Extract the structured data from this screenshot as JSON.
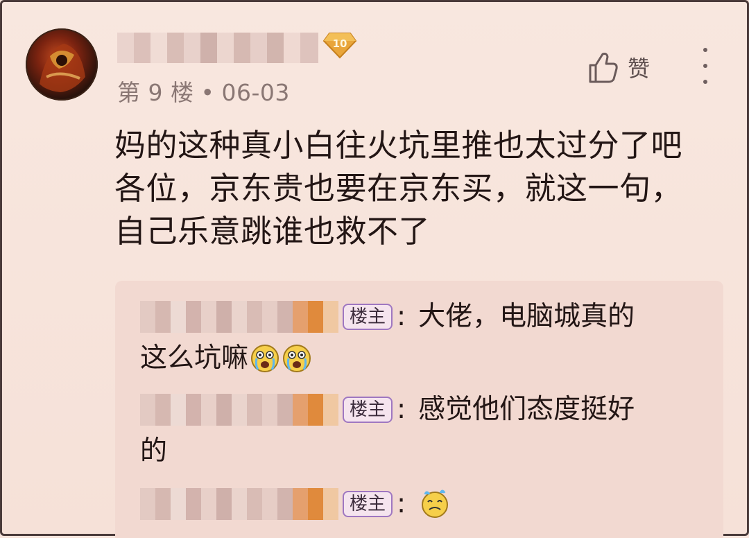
{
  "post": {
    "level": "10",
    "floor_label": "第 9 楼",
    "date": "06-03",
    "like_label": "赞",
    "body_lines": [
      "妈的这种真小白往火坑里推也太过分了吧",
      "各位，京东贵也要在京东买，就这一句，",
      "自己乐意跳谁也救不了"
    ]
  },
  "replies": [
    {
      "badge": "楼主",
      "line1": "大佬，电脑城真的",
      "line2": "这么坑嘛",
      "emojis": [
        "crying-face-icon",
        "crying-face-icon"
      ]
    },
    {
      "badge": "楼主",
      "line1": "感觉他们态度挺好",
      "line2": "的",
      "emojis": []
    },
    {
      "badge": "楼主",
      "line1": "",
      "line2": "",
      "emojis": [
        "sweating-face-icon"
      ]
    }
  ],
  "colors": {
    "background": "#f7e4dc",
    "reply_background": "#f2d9d1",
    "badge_border": "#9f77c1",
    "level_badge": "#e9a53a"
  }
}
